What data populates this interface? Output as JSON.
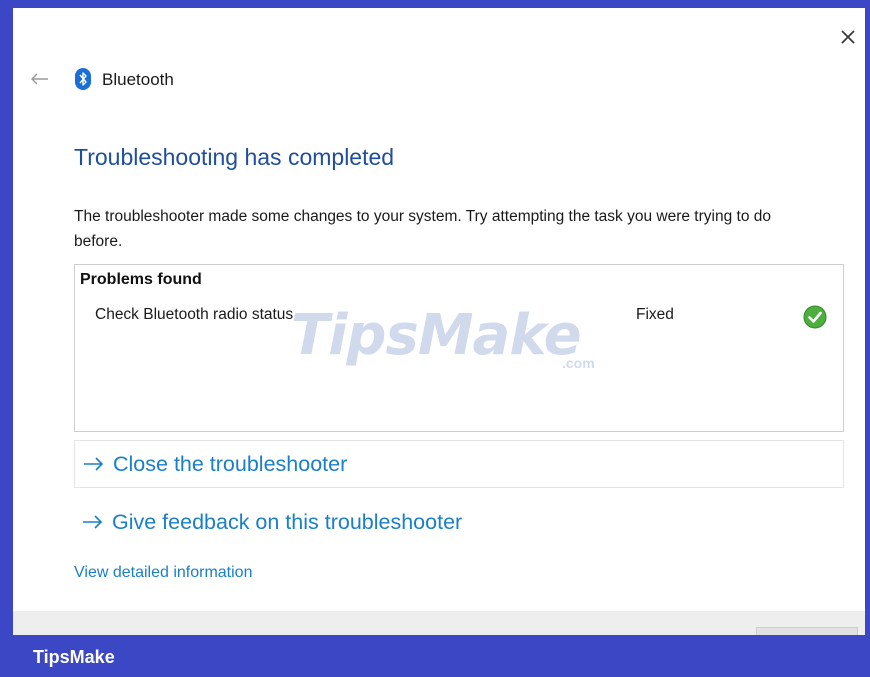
{
  "window": {
    "app_title": "Bluetooth",
    "close_glyph": "✕",
    "back_icon": "back-arrow-icon",
    "app_icon": "bluetooth-icon"
  },
  "main": {
    "heading": "Troubleshooting has completed",
    "description": "The troubleshooter made some changes to your system. Try attempting the task you were trying to do before."
  },
  "problems": {
    "title": "Problems found",
    "items": [
      {
        "name": "Check Bluetooth radio status",
        "status": "Fixed",
        "status_icon": "green-check-icon"
      }
    ]
  },
  "links": {
    "close_troubleshooter": "Close the troubleshooter",
    "give_feedback": "Give feedback on this troubleshooter",
    "view_details": "View detailed information"
  },
  "watermark": {
    "main": "TipsMake",
    "suffix": ".com"
  },
  "branding": {
    "label": "TipsMake"
  },
  "colors": {
    "accent_link": "#1a7fc9",
    "heading": "#1f4e9c",
    "frame": "#3b47c4",
    "success": "#4caf3e"
  }
}
